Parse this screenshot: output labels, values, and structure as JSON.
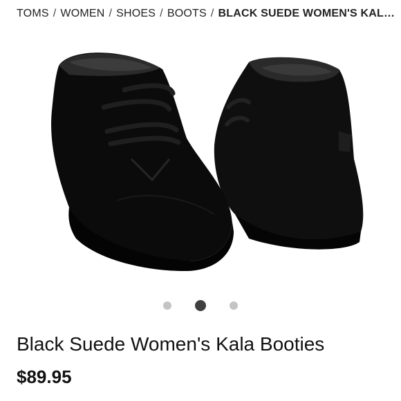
{
  "breadcrumb": {
    "items": [
      "TOMS",
      "WOMEN",
      "SHOES",
      "BOOTS"
    ],
    "separator": "/",
    "current": "BLACK SUEDE WOMEN'S KALA BOOTIES"
  },
  "carousel": {
    "slide_count": 3,
    "active_index": 1
  },
  "product": {
    "title": "Black Suede Women's Kala Booties",
    "price": "$89.95"
  },
  "colors": {
    "boot": "#0d0d0d",
    "dot_active": "#3f3f3f",
    "dot_inactive": "#c4c4c4"
  }
}
